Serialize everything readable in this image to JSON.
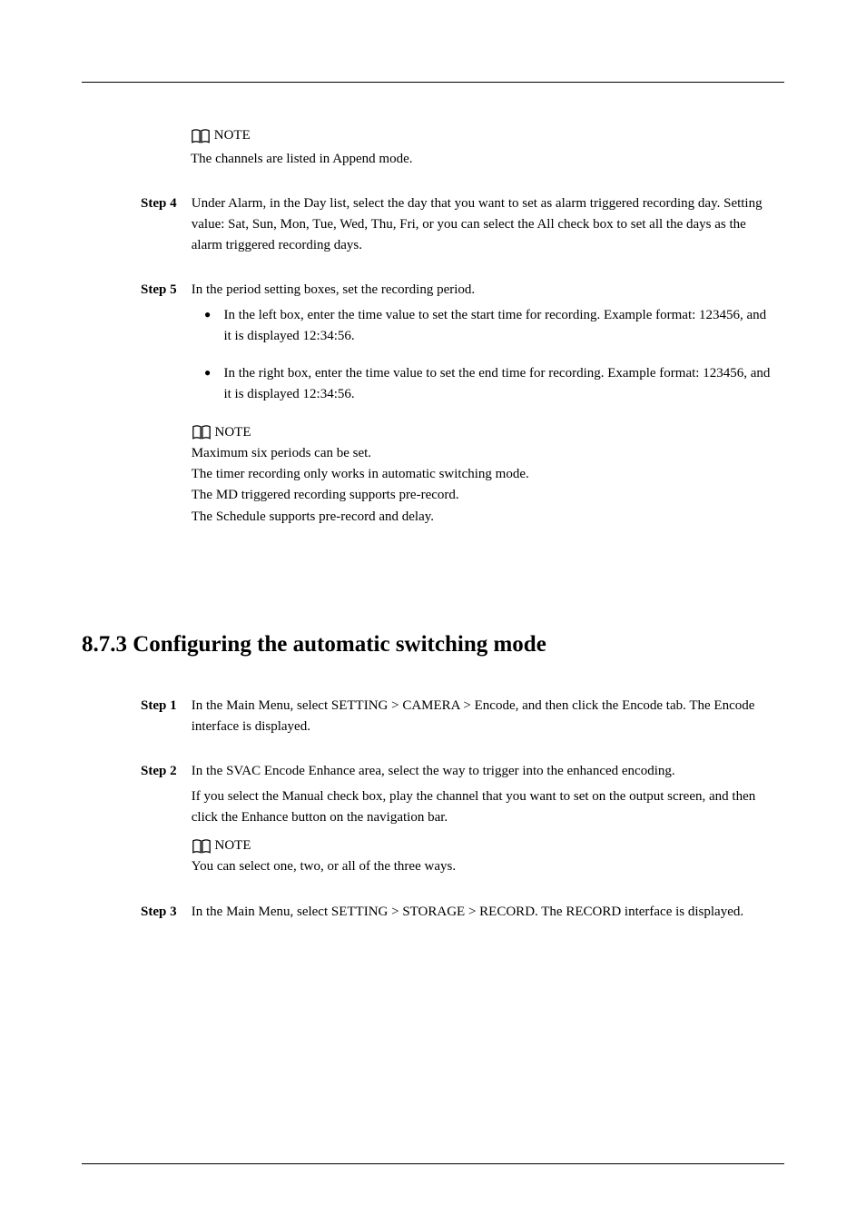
{
  "note1": {
    "label": "NOTE",
    "text": "The channels are listed in Append mode."
  },
  "step4": {
    "label": "Step 4",
    "text": "Under Alarm, in the Day list, select the day that you want to set as alarm triggered recording day. Setting value: Sat, Sun, Mon, Tue, Wed, Thu, Fri, or you can select the All check box to set all the days as the alarm triggered recording days."
  },
  "step5": {
    "label": "Step 5",
    "text": "In the period setting boxes, set the recording period.",
    "bullets": [
      "In the left box, enter the time value to set the start time for recording. Example format: 123456, and it is displayed 12:34:56.",
      "In the right box, enter the time value to set the end time for recording. Example format: 123456, and it is displayed 12:34:56."
    ]
  },
  "note2": {
    "label": "NOTE",
    "lines": [
      "Maximum six periods can be set.",
      "The timer recording only works in automatic switching mode.",
      "The MD triggered recording supports pre-record.",
      "The Schedule supports pre-record and delay."
    ]
  },
  "heading": "8.7.3 Configuring the automatic switching mode",
  "bstep1": {
    "label": "Step 1",
    "text": "In the Main Menu, select SETTING > CAMERA > Encode, and then click the Encode tab. The Encode interface is displayed."
  },
  "bstep2": {
    "label": "Step 2",
    "text": "In the SVAC Encode Enhance area, select the way to trigger into the enhanced encoding.",
    "subtext": "If you select the Manual check box, play the channel that you want to set on the output screen, and then click the Enhance button on the navigation bar.",
    "note_label": "NOTE",
    "note_text": "You can select one, two, or all of the three ways."
  },
  "bstep3": {
    "label": "Step 3",
    "text": "In the Main Menu, select SETTING > STORAGE > RECORD. The RECORD interface is displayed."
  }
}
